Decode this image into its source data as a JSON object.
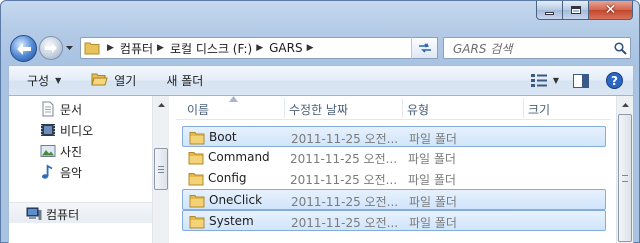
{
  "window": {
    "caption_buttons": {
      "minimize_icon": "minimize-icon",
      "maximize_icon": "maximize-icon",
      "close_label": "✕"
    },
    "colors": {
      "frame": "#a9c3e3",
      "selection_fill": "#d0e5fb",
      "selection_border": "#84acdd",
      "nav_back": "#4c86d1"
    }
  },
  "address": {
    "crumbs": [
      "컴퓨터",
      "로컬 디스크 (F:)",
      "GARS"
    ]
  },
  "search": {
    "placeholder": "GARS 검색"
  },
  "toolbar": {
    "organize_label": "구성",
    "open_label": "열기",
    "new_folder_label": "새 폴더"
  },
  "navpane": {
    "items": [
      {
        "label": "문서",
        "icon": "document-icon"
      },
      {
        "label": "비디오",
        "icon": "video-icon"
      },
      {
        "label": "사진",
        "icon": "picture-icon"
      },
      {
        "label": "음악",
        "icon": "music-icon"
      },
      {
        "label": "컴퓨터",
        "icon": "computer-icon"
      }
    ]
  },
  "list": {
    "columns": [
      "이름",
      "수정한 날짜",
      "유형",
      "크기"
    ],
    "rows": [
      {
        "name": "Boot",
        "date": "2011-11-25 오전...",
        "type": "파일 폴더",
        "selected": true
      },
      {
        "name": "Command",
        "date": "2011-11-25 오전...",
        "type": "파일 폴더",
        "selected": false
      },
      {
        "name": "Config",
        "date": "2011-11-25 오전...",
        "type": "파일 폴더",
        "selected": false
      },
      {
        "name": "OneClick",
        "date": "2011-11-25 오전...",
        "type": "파일 폴더",
        "selected": true
      },
      {
        "name": "System",
        "date": "2011-11-25 오전...",
        "type": "파일 폴더",
        "selected": true
      }
    ]
  }
}
